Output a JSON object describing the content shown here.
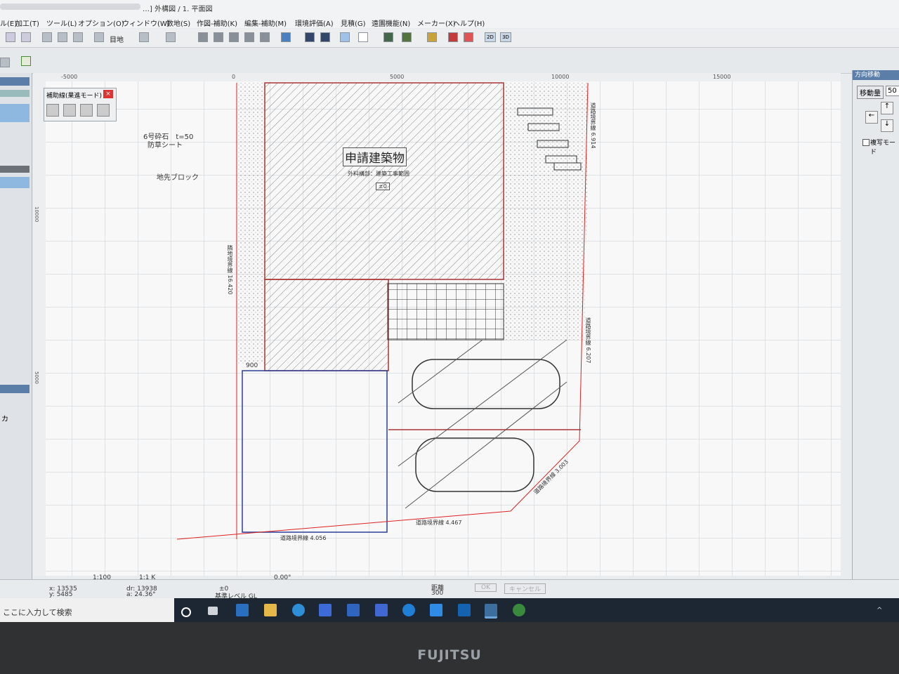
{
  "window": {
    "title": "…] 外構図 / 1. 平面図"
  },
  "menu": [
    "ル(E)",
    "加工(T)",
    "ツール(L)",
    "オプション(O)",
    "ウィンドウ(W)",
    "数地(S)",
    "作図-補助(K)",
    "編集-補助(M)",
    "環境評価(A)",
    "見積(G)",
    "遠園機能(N)",
    "メーカー(X)",
    "ヘルプ(H)"
  ],
  "toolbar": {
    "view_label": "目地",
    "btn_2d": "2D",
    "btn_3d": "3D"
  },
  "ruler": {
    "top": [
      "-5000",
      "0",
      "5000",
      "10000",
      "15000"
    ],
    "left": [
      "10000",
      "5000"
    ]
  },
  "helper_dialog": {
    "title": "補助線(果進モード)"
  },
  "drawing": {
    "building_label": "申請建築物",
    "building_sub": "外料構部：建築工事範囲",
    "building_level": "±0",
    "note_gravel": "6号砕石　t=50",
    "note_sheet": "防草シート",
    "note_block": "地先ブロック",
    "dim_900": "900",
    "boundary_left": "隣地境界線 16.420",
    "boundary_right_top": "道路境界線 6.914",
    "boundary_right_mid": "道路境界線 6.207",
    "boundary_bottom_left": "道路境界線 4.056",
    "boundary_bottom_mid": "道路境界線 4.467",
    "boundary_bottom_right": "道路境界線 3.003"
  },
  "right_panel": {
    "title": "方向移動",
    "move_label": "移動量",
    "move_value": "50",
    "copy_mode": "複写モード"
  },
  "statusbar": {
    "scale": "1:100",
    "scale2": "1:1 K",
    "angle": "0.00°",
    "coord_x": "x: 13535",
    "coord_y": "y: 5485",
    "dist_r": "dr: 13938",
    "dist_a": "a: 24.36°",
    "level": "±0",
    "level_label": "基準レベル GL",
    "distance_label": "距離",
    "distance_value": "300",
    "ok": "OK",
    "cancel": "キャンセル",
    "left_label": "カ"
  },
  "taskbar": {
    "search_placeholder": "ここに入力して検索"
  },
  "bezel": {
    "brand": "FUJITSU"
  }
}
